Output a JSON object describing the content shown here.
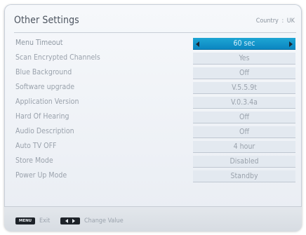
{
  "window": {
    "title": "Other Settings",
    "country_label": "Country",
    "country_separator": ":",
    "country_value": "UK"
  },
  "settings": [
    {
      "label": "Menu Timeout",
      "value": "60 sec",
      "selected": true
    },
    {
      "label": "Scan Encrypted Channels",
      "value": "Yes"
    },
    {
      "label": "Blue Background",
      "value": "Off"
    },
    {
      "label": "Software upgrade",
      "value": "V.5.5.9t"
    },
    {
      "label": "Application Version",
      "value": "V.0.3.4a"
    },
    {
      "label": "Hard Of Hearing",
      "value": "Off"
    },
    {
      "label": "Audio Description",
      "value": "Off"
    },
    {
      "label": "Auto TV OFF",
      "value": "4 hour"
    },
    {
      "label": "Store Mode",
      "value": "Disabled"
    },
    {
      "label": "Power Up Mode",
      "value": "Standby"
    }
  ],
  "footer": {
    "menu_key": "MENU",
    "menu_action": "Exit",
    "lr_key_icon": "left-right-arrows-icon",
    "lr_action": "Change Value"
  },
  "colors": {
    "selected_value_bg": "#1496cc",
    "value_bg": "#e3e9f0",
    "panel_bg": "#eef1f5",
    "text_muted": "#9aa2ac",
    "title_text": "#4d5560"
  }
}
